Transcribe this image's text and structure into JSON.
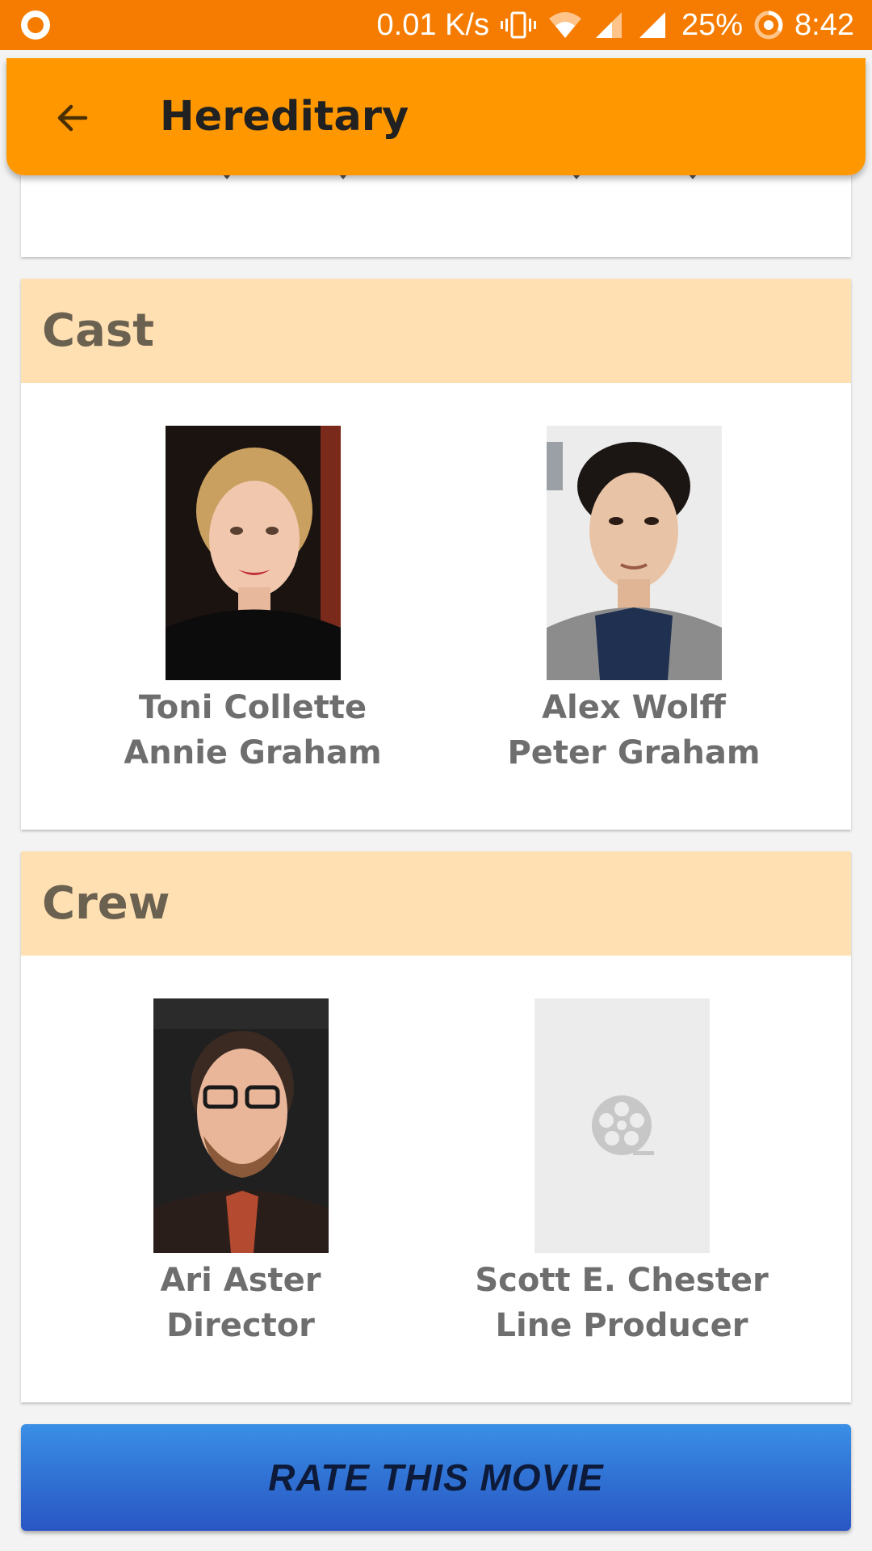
{
  "status_bar": {
    "network_speed": "0.01 K/s",
    "battery": "25%",
    "time": "8:42",
    "icons": [
      "notification-icon",
      "vibrate-icon",
      "wifi-icon",
      "signal-icon",
      "battery-icon"
    ]
  },
  "app_bar": {
    "title": "Hereditary",
    "back_icon": "arrow-back-icon"
  },
  "cast": {
    "title": "Cast",
    "members": [
      {
        "name": "Toni Collette",
        "role": "Annie Graham"
      },
      {
        "name": "Alex Wolff",
        "role": "Peter Graham"
      }
    ]
  },
  "crew": {
    "title": "Crew",
    "members": [
      {
        "name": "Ari Aster",
        "role": "Director"
      },
      {
        "name": "Scott E. Chester",
        "role": "Line Producer",
        "photo": "film-reel-placeholder-icon"
      }
    ]
  },
  "actions": {
    "rate_label": "RATE THIS MOVIE"
  },
  "colors": {
    "status_bar": "#f57c00",
    "app_bar": "#ff9800",
    "section_header": "#ffe0b2",
    "button_blue": "#2f6fd2"
  }
}
